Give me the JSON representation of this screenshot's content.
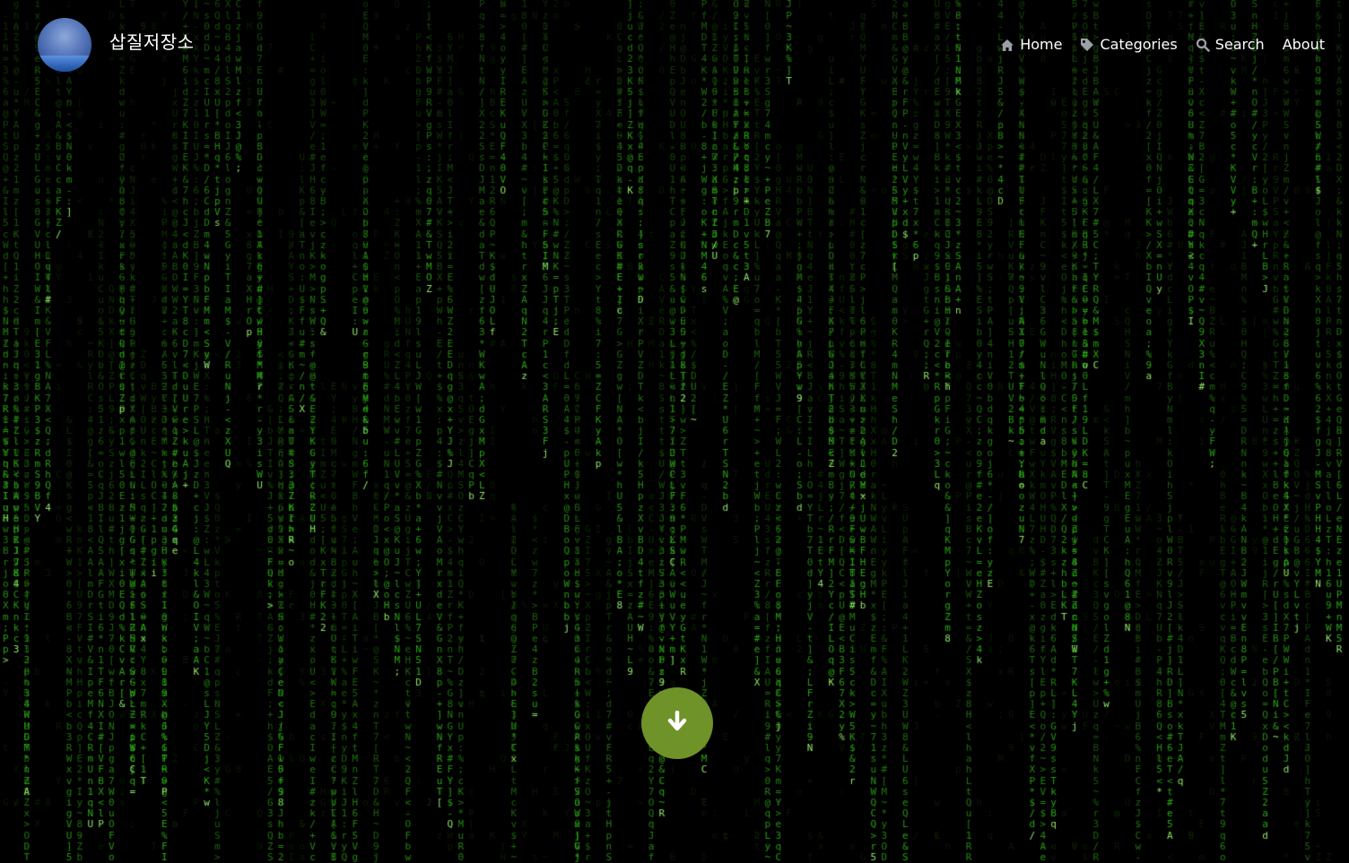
{
  "site": {
    "title": "삽질저장소"
  },
  "nav": {
    "items": [
      {
        "label": "Home",
        "icon": "home-icon"
      },
      {
        "label": "Categories",
        "icon": "tag-icon"
      },
      {
        "label": "Search",
        "icon": "search-icon"
      },
      {
        "label": "About",
        "icon": ""
      }
    ]
  },
  "scroll_button": {
    "icon": "arrow-down-icon",
    "color": "#6f9229"
  },
  "background": {
    "effect": "matrix-rain",
    "char_color": "#3fbf1f",
    "bg_color": "#000000"
  }
}
